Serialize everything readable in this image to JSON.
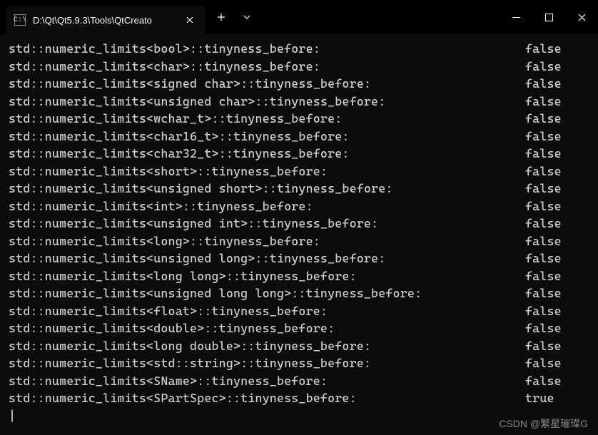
{
  "titlebar": {
    "tab_icon_text": "C:\\",
    "tab_title": "D:\\Qt\\Qt5.9.3\\Tools\\QtCreato"
  },
  "lines": [
    {
      "label": "std::numeric_limits<bool>::tinyness_before:",
      "value": "false"
    },
    {
      "label": "std::numeric_limits<char>::tinyness_before:",
      "value": "false"
    },
    {
      "label": "std::numeric_limits<signed char>::tinyness_before:",
      "value": "false"
    },
    {
      "label": "std::numeric_limits<unsigned char>::tinyness_before:",
      "value": "false"
    },
    {
      "label": "std::numeric_limits<wchar_t>::tinyness_before:",
      "value": "false"
    },
    {
      "label": "std::numeric_limits<char16_t>::tinyness_before:",
      "value": "false"
    },
    {
      "label": "std::numeric_limits<char32_t>::tinyness_before:",
      "value": "false"
    },
    {
      "label": "std::numeric_limits<short>::tinyness_before:",
      "value": "false"
    },
    {
      "label": "std::numeric_limits<unsigned short>::tinyness_before:",
      "value": "false"
    },
    {
      "label": "std::numeric_limits<int>::tinyness_before:",
      "value": "false"
    },
    {
      "label": "std::numeric_limits<unsigned int>::tinyness_before:",
      "value": "false"
    },
    {
      "label": "std::numeric_limits<long>::tinyness_before:",
      "value": "false"
    },
    {
      "label": "std::numeric_limits<unsigned long>::tinyness_before:",
      "value": "false"
    },
    {
      "label": "std::numeric_limits<long long>::tinyness_before:",
      "value": "false"
    },
    {
      "label": "std::numeric_limits<unsigned long long>::tinyness_before:",
      "value": "false"
    },
    {
      "label": "std::numeric_limits<float>::tinyness_before:",
      "value": "false"
    },
    {
      "label": "std::numeric_limits<double>::tinyness_before:",
      "value": "false"
    },
    {
      "label": "std::numeric_limits<long double>::tinyness_before:",
      "value": "false"
    },
    {
      "label": "std::numeric_limits<std::string>::tinyness_before:",
      "value": "false"
    },
    {
      "label": "std::numeric_limits<SName>::tinyness_before:",
      "value": "false"
    },
    {
      "label": "std::numeric_limits<SPartSpec>::tinyness_before:",
      "value": "true"
    }
  ],
  "watermark": "CSDN @繁星璀璨G"
}
